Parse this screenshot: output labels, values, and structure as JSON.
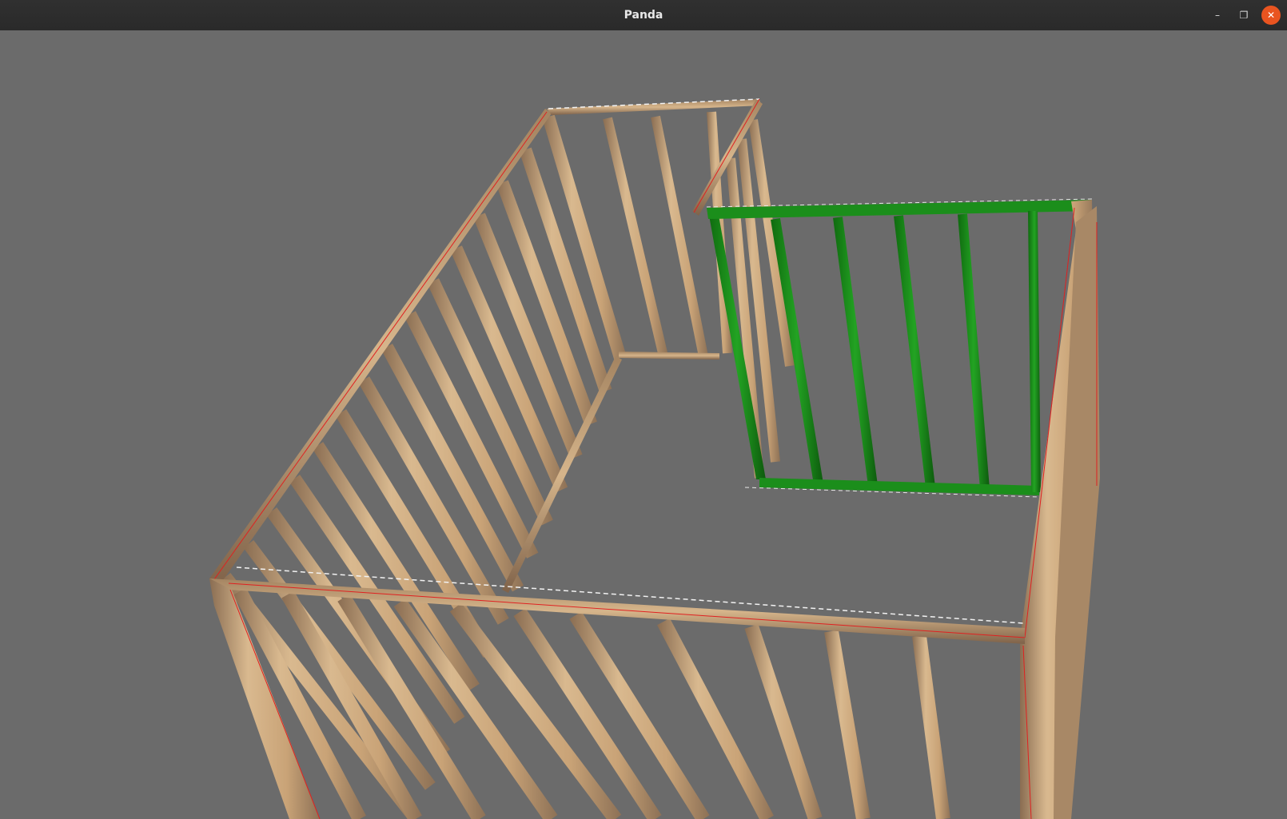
{
  "window": {
    "title": "Panda",
    "controls": {
      "minimize_glyph": "–",
      "maximize_glyph": "❐",
      "close_glyph": "✕"
    }
  },
  "viewport": {
    "background_color": "#6b6b6b",
    "scene": {
      "description_icon": "wall-frame-3d-view",
      "frame_color": "#c9a377",
      "frame_shadow_color": "#8d7156",
      "selected_wall_color": "#1f8f1f",
      "selection_edge_color": "#e02020"
    }
  }
}
